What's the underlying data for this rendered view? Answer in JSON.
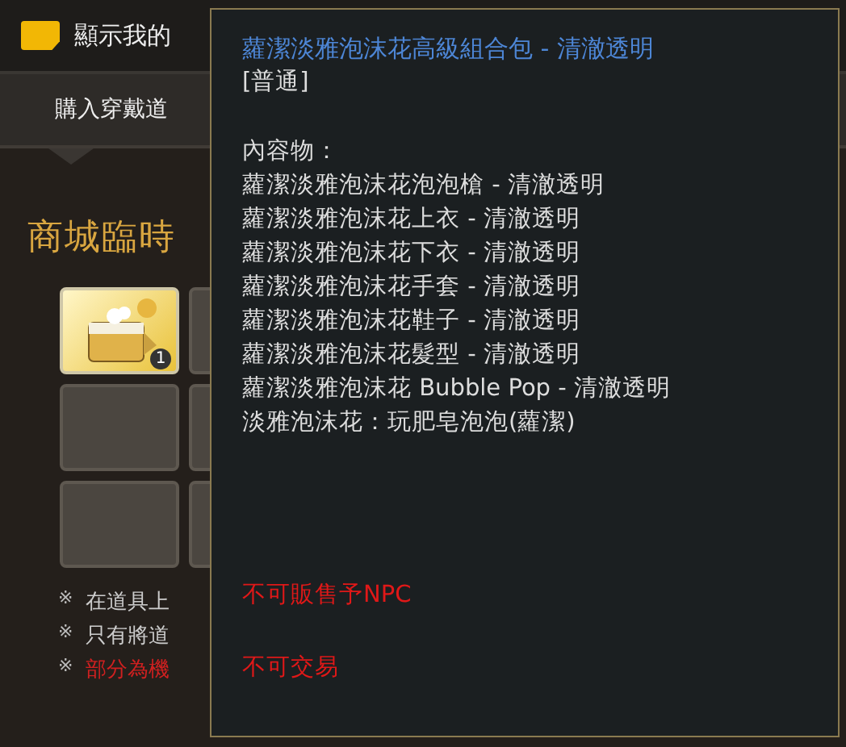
{
  "top_bar": {
    "show_costume": {
      "label": "顯示我的",
      "checked": true
    }
  },
  "tabs": [
    {
      "label": "購入穿戴道",
      "selected": true
    }
  ],
  "storage": {
    "title": "商城臨時",
    "slots": [
      {
        "kind": "item",
        "count": "1"
      },
      {
        "kind": "empty"
      },
      {
        "kind": "empty"
      },
      {
        "kind": "empty"
      },
      {
        "kind": "empty"
      },
      {
        "kind": "empty"
      }
    ]
  },
  "notes": [
    {
      "kind": "normal",
      "mark": "※",
      "text": "在道具上"
    },
    {
      "kind": "normal",
      "mark": "※",
      "text": "只有將道"
    },
    {
      "kind": "warning",
      "mark": "※",
      "text": "部分為機"
    }
  ],
  "tooltip": {
    "title": "蘿潔淡雅泡沫花高級組合包 - 清澈透明",
    "grade": "[普通]",
    "contents_label": "內容物：",
    "contents": [
      "蘿潔淡雅泡沫花泡泡槍 - 清澈透明",
      "蘿潔淡雅泡沫花上衣 - 清澈透明",
      "蘿潔淡雅泡沫花下衣 - 清澈透明",
      "蘿潔淡雅泡沫花手套 - 清澈透明",
      "蘿潔淡雅泡沫花鞋子 - 清澈透明",
      "蘿潔淡雅泡沫花髮型 - 清澈透明",
      "蘿潔淡雅泡沫花 Bubble Pop - 清澈透明",
      "淡雅泡沫花：玩肥皂泡泡(蘿潔)"
    ],
    "restrictions": [
      "不可販售予NPC",
      "不可交易"
    ]
  }
}
